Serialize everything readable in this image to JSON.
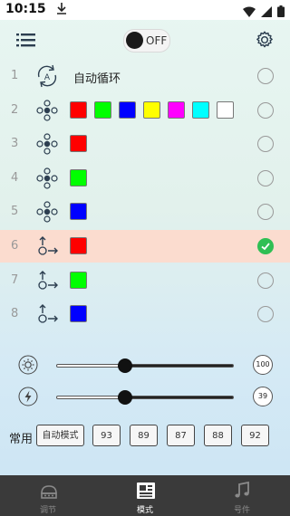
{
  "status_bar": {
    "time": "10:15",
    "download_icon": "download-arrow-icon"
  },
  "header": {
    "power_state": "OFF"
  },
  "modes": [
    {
      "num": "1",
      "icon": "auto-cycle-icon",
      "label": "自动循环",
      "swatches": [],
      "selected": false
    },
    {
      "num": "2",
      "icon": "flower-icon",
      "label": "",
      "swatches": [
        "#ff0000",
        "#00ff00",
        "#0000ff",
        "#ffff00",
        "#ff00ff",
        "#00ffff",
        "#ffffff"
      ],
      "selected": false
    },
    {
      "num": "3",
      "icon": "flower-icon",
      "label": "",
      "swatches": [
        "#ff0000"
      ],
      "selected": false
    },
    {
      "num": "4",
      "icon": "flower-icon",
      "label": "",
      "swatches": [
        "#00ff00"
      ],
      "selected": false
    },
    {
      "num": "5",
      "icon": "flower-icon",
      "label": "",
      "swatches": [
        "#0000ff"
      ],
      "selected": false
    },
    {
      "num": "6",
      "icon": "jump-icon",
      "label": "",
      "swatches": [
        "#ff0000"
      ],
      "selected": true
    },
    {
      "num": "7",
      "icon": "jump-icon",
      "label": "",
      "swatches": [
        "#00ff00"
      ],
      "selected": false
    },
    {
      "num": "8",
      "icon": "jump-icon",
      "label": "",
      "swatches": [
        "#0000ff"
      ],
      "selected": false
    }
  ],
  "sliders": {
    "brightness": {
      "icon": "brightness-icon",
      "value": "100",
      "level": 0.39
    },
    "speed": {
      "icon": "speed-icon",
      "value": "39",
      "level": 0.39
    }
  },
  "presets": {
    "label": "常用",
    "buttons": [
      "自动模式",
      "93",
      "89",
      "87",
      "88",
      "92"
    ]
  },
  "nav": {
    "tabs": [
      {
        "label": "调节",
        "icon": "adjust-icon",
        "active": false
      },
      {
        "label": "模式",
        "icon": "mode-icon",
        "active": true
      },
      {
        "label": "号件",
        "icon": "music-icon",
        "active": false
      }
    ]
  },
  "colors": {
    "selected_row": "#fbdccf",
    "check_green": "#2fbf54",
    "nav_bg": "#3a3a3a"
  }
}
